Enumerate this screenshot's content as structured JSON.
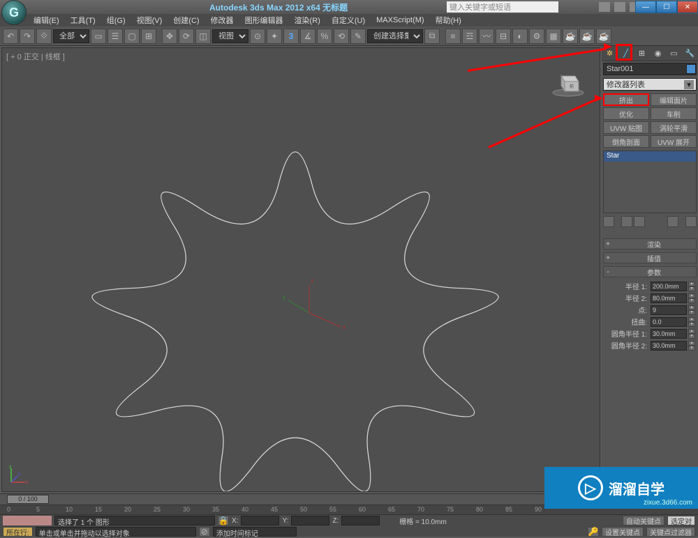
{
  "title": "Autodesk 3ds Max 2012 x64   无标题",
  "search_placeholder": "键入关键字或短语",
  "menu": [
    "编辑(E)",
    "工具(T)",
    "组(G)",
    "视图(V)",
    "创建(C)",
    "修改器",
    "图形编辑器",
    "渲染(R)",
    "自定义(U)",
    "MAXScript(M)",
    "帮助(H)"
  ],
  "toolbar": {
    "filter": "全部",
    "view_label": "视图",
    "sel_mode": "创建选择集"
  },
  "viewport": {
    "label": "[ + 0 正交 | 线框 ]"
  },
  "side": {
    "object_name": "Star001",
    "modifier_list": "修改器列表",
    "buttons": [
      "挤出",
      "编辑面片",
      "优化",
      "车削",
      "UVW 贴图",
      "涡轮平滑",
      "倒角剖面",
      "UVW 展开"
    ],
    "stack_item": "Star",
    "rollouts": [
      {
        "sign": "+",
        "label": "渲染"
      },
      {
        "sign": "+",
        "label": "插值"
      },
      {
        "sign": "-",
        "label": "参数"
      }
    ],
    "params": [
      {
        "label": "半径 1:",
        "value": "200.0mm"
      },
      {
        "label": "半径 2:",
        "value": "80.0mm"
      },
      {
        "label": "点:",
        "value": "9"
      },
      {
        "label": "扭曲:",
        "value": "0.0"
      },
      {
        "label": "圆角半径 1:",
        "value": "30.0mm"
      },
      {
        "label": "圆角半径 2:",
        "value": "30.0mm"
      }
    ]
  },
  "timeline": {
    "handle": "0 / 100",
    "ticks": [
      "0",
      "5",
      "10",
      "15",
      "20",
      "25",
      "30",
      "35",
      "40",
      "45",
      "50",
      "55",
      "60",
      "65",
      "70",
      "75",
      "80",
      "85",
      "90"
    ]
  },
  "status": {
    "line1": "选择了 1 个 图形",
    "line2": "单击或单击并拖动以选择对象",
    "x": "X:",
    "y": "Y:",
    "z": "Z:",
    "grid": "栅格 = 10.0mm",
    "btn_in": "所在行:",
    "auto_key": "自动关键点",
    "sel_key": "选定对",
    "set_key": "设置关键点",
    "key_filter": "关键点过滤器",
    "add_time": "添加时间标记"
  },
  "watermark": {
    "text": "溜溜自学",
    "url": "zixue.3d66.com"
  },
  "chart_data": {
    "type": "star-spline",
    "points": 9,
    "radius1_mm": 200.0,
    "radius2_mm": 80.0,
    "twist": 0.0,
    "fillet1_mm": 30.0,
    "fillet2_mm": 30.0
  }
}
